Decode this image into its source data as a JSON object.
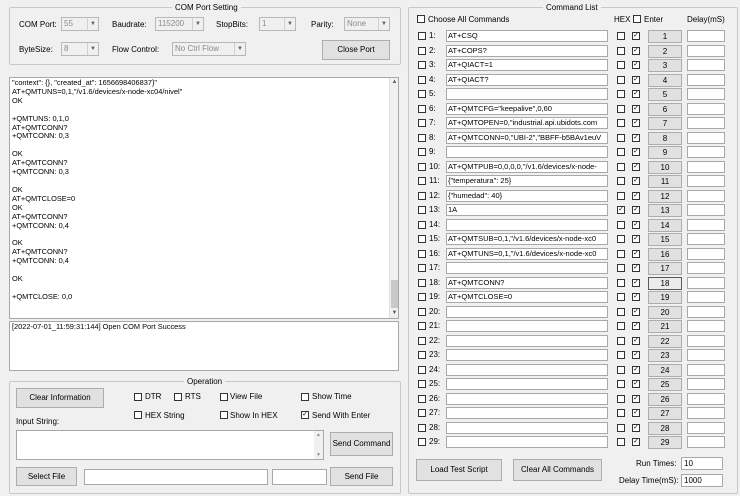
{
  "com_settings": {
    "title": "COM Port Setting",
    "com_port_label": "COM Port:",
    "com_port_value": "55",
    "baudrate_label": "Baudrate:",
    "baudrate_value": "115200",
    "stopbits_label": "StopBits:",
    "stopbits_value": "1",
    "parity_label": "Parity:",
    "parity_value": "None",
    "bytesize_label": "ByteSize:",
    "bytesize_value": "8",
    "flow_label": "Flow Control:",
    "flow_value": "No Ctrl Flow",
    "close_port_label": "Close Port"
  },
  "terminal": {
    "text": "\"context\": {}, \"created_at\": 1656698406837}\"\nAT+QMTUNS=0,1,\"/v1.6/devices/x-node-xc04/nivel\"\nOK\n\n+QMTUNS: 0,1,0\nAT+QMTCONN?\n+QMTCONN: 0,3\n\nOK\nAT+QMTCONN?\n+QMTCONN: 0,3\n\nOK\nAT+QMTCLOSE=0\nOK\nAT+QMTCONN?\n+QMTCONN: 0,4\n\nOK\nAT+QMTCONN?\n+QMTCONN: 0,4\n\nOK\n\n+QMTCLOSE: 0,0"
  },
  "status_log": {
    "text": "[2022-07-01_11:59:31:144] Open COM Port Success"
  },
  "operation": {
    "title": "Operation",
    "clear_info_label": "Clear Information",
    "dtr_label": "DTR",
    "rts_label": "RTS",
    "view_file_label": "View File",
    "show_time_label": "Show Time",
    "hex_string_label": "HEX String",
    "show_in_hex_label": "Show In HEX",
    "send_with_enter_label": "Send With Enter",
    "send_with_enter_checked": "✓",
    "input_string_label": "Input String:",
    "send_command_label": "Send Command",
    "select_file_label": "Select File",
    "send_file_label": "Send File"
  },
  "command_list": {
    "title": "Command List",
    "choose_all_label": "Choose All Commands",
    "hex_header": "HEX",
    "enter_header": "Enter",
    "delay_header": "Delay(mS)",
    "load_test_script_label": "Load Test Script",
    "clear_all_label": "Clear All Commands",
    "run_times_label": "Run Times:",
    "run_times_value": "10",
    "delay_time_label": "Delay Time(mS):",
    "delay_time_value": "1000",
    "commands": [
      {
        "num": "1:",
        "text": "AT+CSQ",
        "hex": "",
        "enter": "✓",
        "btn": "1"
      },
      {
        "num": "2:",
        "text": "AT+COPS?",
        "hex": "",
        "enter": "✓",
        "btn": "2"
      },
      {
        "num": "3:",
        "text": "AT+QIACT=1",
        "hex": "",
        "enter": "✓",
        "btn": "3"
      },
      {
        "num": "4:",
        "text": "AT+QIACT?",
        "hex": "",
        "enter": "✓",
        "btn": "4"
      },
      {
        "num": "5:",
        "text": "",
        "hex": "",
        "enter": "✓",
        "btn": "5"
      },
      {
        "num": "6:",
        "text": "AT+QMTCFG=\"keepalive\",0,60",
        "hex": "",
        "enter": "✓",
        "btn": "6"
      },
      {
        "num": "7:",
        "text": "AT+QMTOPEN=0,\"industrial.api.ubidots.com",
        "hex": "",
        "enter": "✓",
        "btn": "7"
      },
      {
        "num": "8:",
        "text": "AT+QMTCONN=0,\"UBI-2\",\"BBFF-b5BAv1euV",
        "hex": "",
        "enter": "✓",
        "btn": "8"
      },
      {
        "num": "9:",
        "text": "",
        "hex": "",
        "enter": "✓",
        "btn": "9"
      },
      {
        "num": "10:",
        "text": "AT+QMTPUB=0,0,0,0,\"/v1.6/devices/x-node-",
        "hex": "",
        "enter": "✓",
        "btn": "10"
      },
      {
        "num": "11:",
        "text": "{\"temperatura\": 25}",
        "hex": "",
        "enter": "✓",
        "btn": "11"
      },
      {
        "num": "12:",
        "text": "{\"humedad\": 40}",
        "hex": "",
        "enter": "✓",
        "btn": "12"
      },
      {
        "num": "13:",
        "text": "1A",
        "hex": "✓",
        "enter": "✓",
        "btn": "13"
      },
      {
        "num": "14:",
        "text": "",
        "hex": "",
        "enter": "✓",
        "btn": "14"
      },
      {
        "num": "15:",
        "text": "AT+QMTSUB=0,1,\"/v1.6/devices/x-node-xc0",
        "hex": "",
        "enter": "✓",
        "btn": "15"
      },
      {
        "num": "16:",
        "text": "AT+QMTUNS=0,1,\"/v1.6/devices/x-node-xc0",
        "hex": "",
        "enter": "✓",
        "btn": "16"
      },
      {
        "num": "17:",
        "text": "",
        "hex": "",
        "enter": "✓",
        "btn": "17"
      },
      {
        "num": "18:",
        "text": "AT+QMTCONN?",
        "hex": "",
        "enter": "✓",
        "btn": "18"
      },
      {
        "num": "19:",
        "text": "AT+QMTCLOSE=0",
        "hex": "",
        "enter": "✓",
        "btn": "19"
      },
      {
        "num": "20:",
        "text": "",
        "hex": "",
        "enter": "✓",
        "btn": "20"
      },
      {
        "num": "21:",
        "text": "",
        "hex": "",
        "enter": "✓",
        "btn": "21"
      },
      {
        "num": "22:",
        "text": "",
        "hex": "",
        "enter": "✓",
        "btn": "22"
      },
      {
        "num": "23:",
        "text": "",
        "hex": "",
        "enter": "✓",
        "btn": "23"
      },
      {
        "num": "24:",
        "text": "",
        "hex": "",
        "enter": "✓",
        "btn": "24"
      },
      {
        "num": "25:",
        "text": "",
        "hex": "",
        "enter": "✓",
        "btn": "25"
      },
      {
        "num": "26:",
        "text": "",
        "hex": "",
        "enter": "✓",
        "btn": "26"
      },
      {
        "num": "27:",
        "text": "",
        "hex": "",
        "enter": "✓",
        "btn": "27"
      },
      {
        "num": "28:",
        "text": "",
        "hex": "",
        "enter": "✓",
        "btn": "28"
      },
      {
        "num": "29:",
        "text": "",
        "hex": "",
        "enter": "✓",
        "btn": "29"
      }
    ]
  }
}
